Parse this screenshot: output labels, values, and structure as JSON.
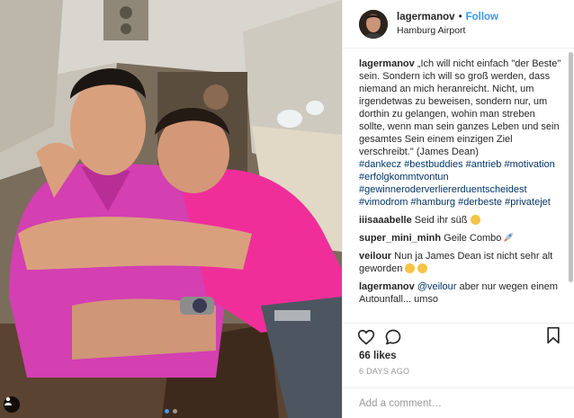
{
  "header": {
    "username": "lagermanov",
    "separator": "•",
    "follow_label": "Follow",
    "location": "Hamburg Airport"
  },
  "caption": {
    "user": "lagermanov",
    "text": "„Ich will nicht einfach \"der Beste\" sein. Sondern ich will so groß werden, dass niemand an mich heranreicht. Nicht, um irgendetwas zu beweisen, sondern nur, um dorthin zu gelangen, wohin man streben sollte, wenn man sein ganzes Leben und sein gesamtes Sein einem einzigen Ziel verschreibt.\" (James Dean)",
    "hashtags": [
      "#dankecz",
      "#bestbuddies",
      "#antrieb",
      "#motivation",
      "#erfolgkommtvontun",
      "#gewinneroderverliererduentscheidest",
      "#vimodrom",
      "#hamburg",
      "#derbeste",
      "#privatejet"
    ]
  },
  "comments": [
    {
      "user": "iiisaaabelle",
      "text": "Seid ihr süß",
      "emoji": "smiling-face"
    },
    {
      "user": "super_mini_minh",
      "text": "Geile Combo",
      "emoji": "rocket"
    },
    {
      "user": "veilour",
      "text": "Nun ja James Dean ist nicht sehr alt geworden",
      "emoji": "grinning-face"
    },
    {
      "user": "lagermanov",
      "mention": "@veilour",
      "text": "aber nur wegen einem Autounfall... umso"
    }
  ],
  "likes": "66 likes",
  "date": "6 DAYS AGO",
  "add_comment_placeholder": "Add a comment…",
  "icons": {
    "like": "heart-icon",
    "comment": "comment-bubble-icon",
    "save": "bookmark-icon",
    "tagged": "user-tag-icon"
  },
  "colors": {
    "follow": "#3897f0",
    "hashtag": "#003569",
    "carousel_active": "#3e99ed"
  }
}
